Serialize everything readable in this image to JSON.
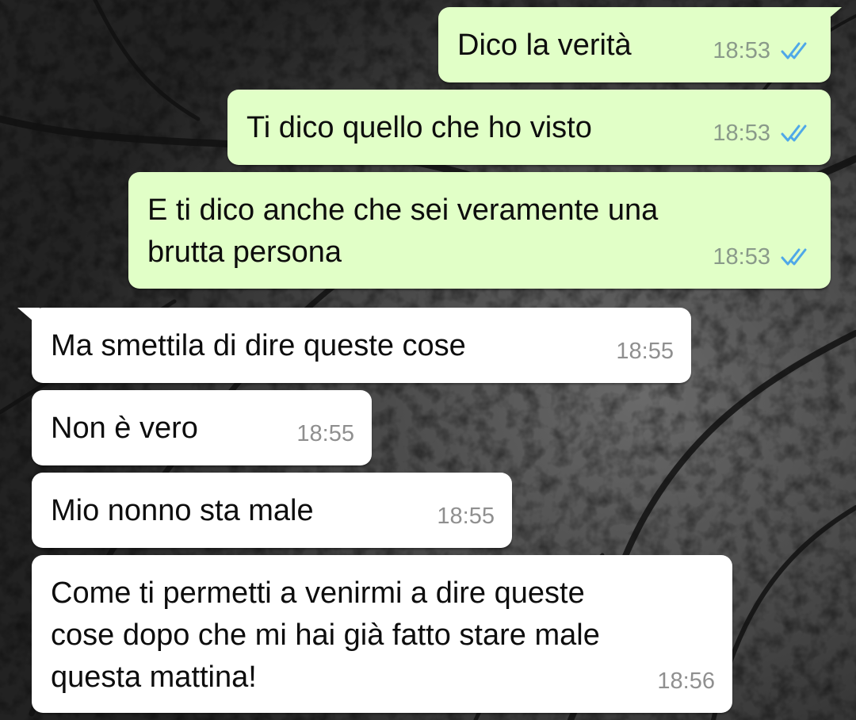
{
  "chat": {
    "messages": [
      {
        "direction": "outgoing",
        "text": "Dico la verità",
        "time": "18:53",
        "status": "read-double-check-icon"
      },
      {
        "direction": "outgoing",
        "text": "Ti dico quello che ho visto",
        "time": "18:53",
        "status": "read-double-check-icon"
      },
      {
        "direction": "outgoing",
        "text": "E ti dico anche che sei veramente una\nbrutta persona",
        "time": "18:53",
        "status": "read-double-check-icon"
      },
      {
        "direction": "incoming",
        "text": "Ma smettila di dire queste cose",
        "time": "18:55"
      },
      {
        "direction": "incoming",
        "text": "Non è vero",
        "time": "18:55"
      },
      {
        "direction": "incoming",
        "text": "Mio nonno sta male",
        "time": "18:55"
      },
      {
        "direction": "incoming",
        "text": "Come ti permetti a venirmi a dire queste\ncose dopo che mi hai già fatto stare male\nquesta mattina!",
        "time": "18:56"
      }
    ]
  },
  "colors": {
    "outgoing_bubble": "#e1ffc7",
    "incoming_bubble": "#ffffff",
    "read_tick": "#4fa8e8",
    "wallpaper": "#3a3a3a"
  },
  "wallpaper": "dark-tree-canopy-photo"
}
